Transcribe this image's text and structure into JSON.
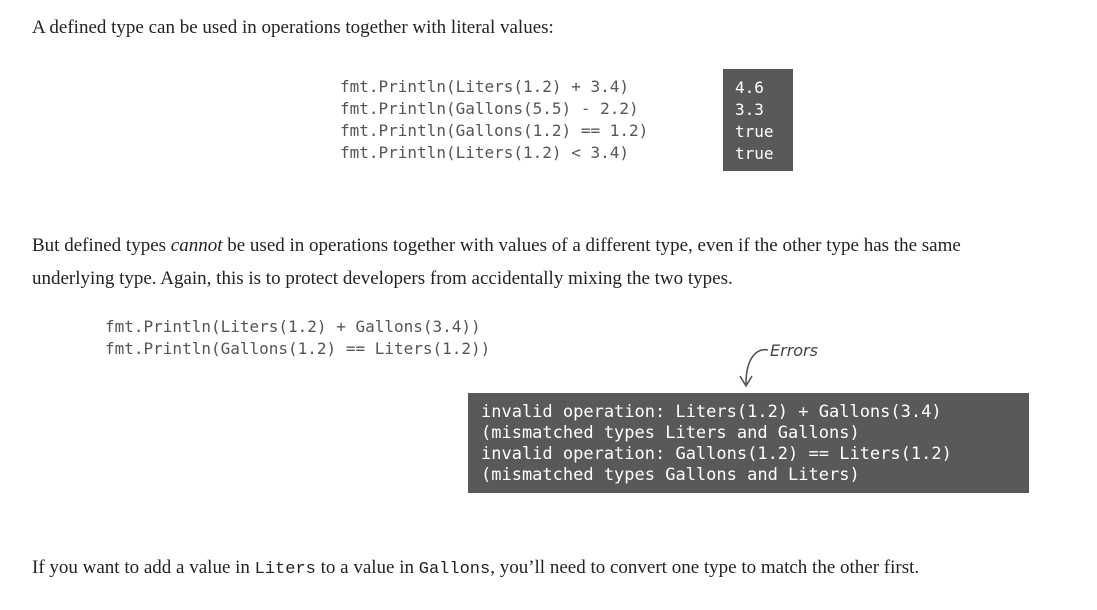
{
  "intro": "A defined type can be used in operations together with literal values:",
  "code1": {
    "lines": [
      "fmt.Println(Liters(1.2) + 3.4)",
      "fmt.Println(Gallons(5.5) - 2.2)",
      "fmt.Println(Gallons(1.2) == 1.2)",
      "fmt.Println(Liters(1.2) < 3.4)"
    ],
    "output": [
      "4.6",
      "3.3",
      "true",
      "true"
    ]
  },
  "para2": {
    "before": "But defined types ",
    "emphasis": "cannot",
    "after_line1": " be used in operations together with values of a different type, even if the other type has the same",
    "line2": "underlying type. Again, this is to protect developers from accidentally mixing the two types."
  },
  "code2": {
    "lines": [
      "fmt.Println(Liters(1.2) + Gallons(3.4))",
      "fmt.Println(Gallons(1.2) == Liters(1.2))"
    ],
    "annotation": "Errors",
    "errors": [
      "invalid operation: Liters(1.2) + Gallons(3.4)",
      "(mismatched types Liters and Gallons)",
      "invalid operation: Gallons(1.2) == Liters(1.2)",
      "(mismatched types Gallons and Liters)"
    ]
  },
  "para3": {
    "t1": "If you want to add a value in ",
    "c1": "Liters",
    "t2": " to a value in ",
    "c2": "Gallons",
    "t3": ", you’ll need to convert one type to match the other first."
  }
}
